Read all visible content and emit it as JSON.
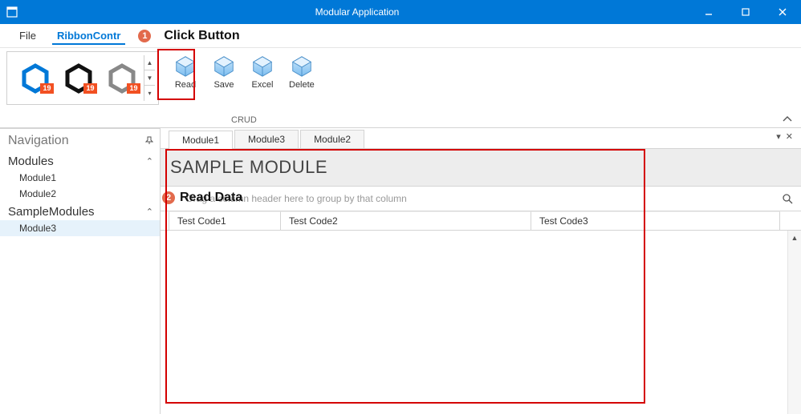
{
  "titlebar": {
    "title": "Modular Application"
  },
  "menu": {
    "file": "File",
    "ribbon": "RibbonContr"
  },
  "annotations": {
    "step1_num": "1",
    "step1_label": "Click Button",
    "step2_num": "2",
    "step2_label": "Read Data"
  },
  "theme_badge": "19",
  "ribbon": {
    "read": "Read",
    "save": "Save",
    "excel": "Excel",
    "delete": "Delete",
    "group_label": "CRUD"
  },
  "sidebar": {
    "title": "Navigation",
    "group_modules": "Modules",
    "item_module1": "Module1",
    "item_module2": "Module2",
    "group_sample": "SampleModules",
    "item_module3": "Module3"
  },
  "tabs": {
    "t1": "Module1",
    "t2": "Module3",
    "t3": "Module2"
  },
  "module": {
    "header": "SAMPLE MODULE",
    "group_hint": "Drag a column header here to group by that column",
    "col1": "Test Code1",
    "col2": "Test Code2",
    "col3": "Test Code3"
  }
}
